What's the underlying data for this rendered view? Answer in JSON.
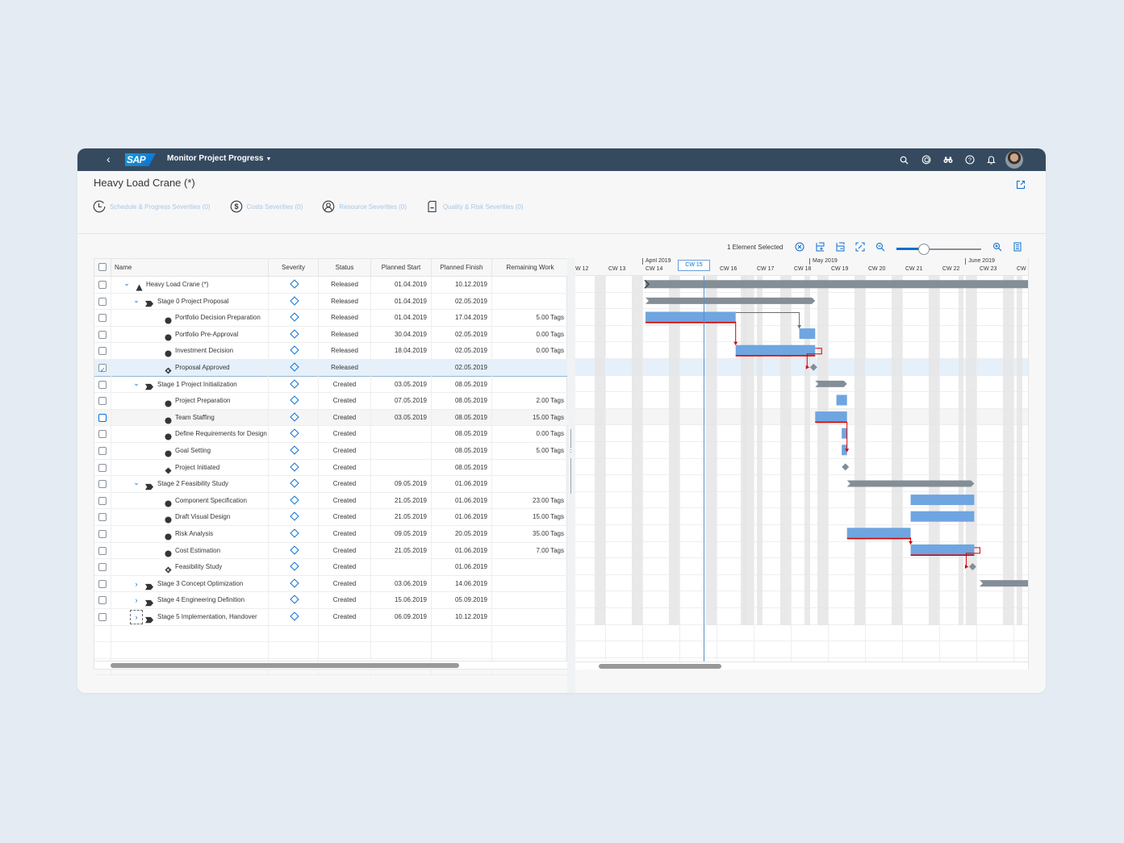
{
  "shell": {
    "back_label": "<",
    "logo": "SAP",
    "app_title": "Monitor Project Progress",
    "actions": [
      "search-icon",
      "co-pilot-icon",
      "binoculars-icon",
      "help-icon",
      "notification-bell-icon"
    ]
  },
  "header": {
    "title": "Heavy Load Crane (*)",
    "share_icon": "share-icon",
    "severity_tabs": [
      {
        "icon": "clock-icon",
        "label": "Schedule & Progress Severities (0)"
      },
      {
        "icon": "dollar-icon",
        "label": "Costs Severities (0)"
      },
      {
        "icon": "person-icon",
        "label": "Resource Severities (0)"
      },
      {
        "icon": "document-icon",
        "label": "Quality & Risk Severities (0)"
      }
    ]
  },
  "toolbar": {
    "selection_text": "1 Element Selected",
    "icons": [
      "clear-selection-icon",
      "expand-all-icon",
      "collapse-all-icon",
      "fit-to-screen-icon",
      "zoom-out-icon",
      "zoom-in-icon",
      "settings-icon"
    ],
    "zoom_level": 0.32
  },
  "table": {
    "columns": [
      "Name",
      "Severity",
      "Status",
      "Planned Start",
      "Planned Finish",
      "Remaining Work"
    ],
    "rows": [
      {
        "level": 0,
        "expand": "open",
        "type": "project",
        "name": "Heavy Load Crane (*)",
        "status": "Released",
        "start": "01.04.2019",
        "finish": "10.12.2019",
        "work": "",
        "checked": false
      },
      {
        "level": 1,
        "expand": "open",
        "type": "phase",
        "name": "Stage 0 Project Proposal",
        "status": "Released",
        "start": "01.04.2019",
        "finish": "02.05.2019",
        "work": "",
        "checked": false
      },
      {
        "level": 2,
        "expand": "",
        "type": "task",
        "name": "Portfolio Decision Preparation",
        "status": "Released",
        "start": "01.04.2019",
        "finish": "17.04.2019",
        "work": "5.00 Tags",
        "checked": false
      },
      {
        "level": 2,
        "expand": "",
        "type": "task",
        "name": "Portfolio Pre-Approval",
        "status": "Released",
        "start": "30.04.2019",
        "finish": "02.05.2019",
        "work": "0.00 Tags",
        "checked": false
      },
      {
        "level": 2,
        "expand": "",
        "type": "task",
        "name": "Investment Decision",
        "status": "Released",
        "start": "18.04.2019",
        "finish": "02.05.2019",
        "work": "0.00 Tags",
        "checked": false
      },
      {
        "level": 2,
        "expand": "",
        "type": "gate",
        "name": "Proposal Approved",
        "status": "Released",
        "start": "",
        "finish": "02.05.2019",
        "work": "",
        "checked": true
      },
      {
        "level": 1,
        "expand": "open",
        "type": "phase",
        "name": "Stage 1 Project Initialization",
        "status": "Created",
        "start": "03.05.2019",
        "finish": "08.05.2019",
        "work": "",
        "checked": false
      },
      {
        "level": 2,
        "expand": "",
        "type": "task",
        "name": "Project Preparation",
        "status": "Created",
        "start": "07.05.2019",
        "finish": "08.05.2019",
        "work": "2.00 Tags",
        "checked": false
      },
      {
        "level": 2,
        "expand": "",
        "type": "task",
        "name": "Team Staffing",
        "status": "Created",
        "start": "03.05.2019",
        "finish": "08.05.2019",
        "work": "15.00 Tags",
        "checked": false
      },
      {
        "level": 2,
        "expand": "",
        "type": "task",
        "name": "Define Requirements for Design",
        "status": "Created",
        "start": "",
        "finish": "08.05.2019",
        "work": "0.00 Tags",
        "checked": false
      },
      {
        "level": 2,
        "expand": "",
        "type": "task",
        "name": "Goal Setting",
        "status": "Created",
        "start": "",
        "finish": "08.05.2019",
        "work": "5.00 Tags",
        "checked": false
      },
      {
        "level": 2,
        "expand": "",
        "type": "milestone",
        "name": "Project Initiated",
        "status": "Created",
        "start": "",
        "finish": "08.05.2019",
        "work": "",
        "checked": false
      },
      {
        "level": 1,
        "expand": "open",
        "type": "phase",
        "name": "Stage 2 Feasibility Study",
        "status": "Created",
        "start": "09.05.2019",
        "finish": "01.06.2019",
        "work": "",
        "checked": false
      },
      {
        "level": 2,
        "expand": "",
        "type": "task",
        "name": "Component Specification",
        "status": "Created",
        "start": "21.05.2019",
        "finish": "01.06.2019",
        "work": "23.00 Tags",
        "checked": false
      },
      {
        "level": 2,
        "expand": "",
        "type": "task",
        "name": "Draft Visual Design",
        "status": "Created",
        "start": "21.05.2019",
        "finish": "01.06.2019",
        "work": "15.00 Tags",
        "checked": false
      },
      {
        "level": 2,
        "expand": "",
        "type": "task",
        "name": "Risk Analysis",
        "status": "Created",
        "start": "09.05.2019",
        "finish": "20.05.2019",
        "work": "35.00 Tags",
        "checked": false
      },
      {
        "level": 2,
        "expand": "",
        "type": "task",
        "name": "Cost Estimation",
        "status": "Created",
        "start": "21.05.2019",
        "finish": "01.06.2019",
        "work": "7.00 Tags",
        "checked": false
      },
      {
        "level": 2,
        "expand": "",
        "type": "gate",
        "name": "Feasibility Study",
        "status": "Created",
        "start": "",
        "finish": "01.06.2019",
        "work": "",
        "checked": false
      },
      {
        "level": 1,
        "expand": "closed",
        "type": "phase",
        "name": "Stage 3 Concept Optimization",
        "status": "Created",
        "start": "03.06.2019",
        "finish": "14.06.2019",
        "work": "",
        "checked": false
      },
      {
        "level": 1,
        "expand": "closed",
        "type": "phase",
        "name": "Stage 4 Engineering Definition",
        "status": "Created",
        "start": "15.06.2019",
        "finish": "05.09.2019",
        "work": "",
        "checked": false
      },
      {
        "level": 1,
        "expand": "closed",
        "type": "phase",
        "name": "Stage 5 Implementation, Handover",
        "status": "Created",
        "start": "06.09.2019",
        "finish": "10.12.2019",
        "work": "",
        "checked": false
      }
    ],
    "severity_icon": "diamond-icon",
    "empty_rows": 3
  },
  "gantt": {
    "months": [
      {
        "label": "April 2019",
        "week_index": 2
      },
      {
        "label": "May 2019",
        "week_index": 6.5
      },
      {
        "label": "June 2019",
        "week_index": 10.7
      }
    ],
    "weeks": [
      "W 12",
      "CW 13",
      "CW 14",
      "CW 15",
      "CW 16",
      "CW 17",
      "CW 18",
      "CW 19",
      "CW 20",
      "CW 21",
      "CW 22",
      "CW 23",
      "CW"
    ],
    "current_week": "CW 15",
    "colors": {
      "summary": "#848e96",
      "task": "#6fa5e0",
      "critical": "#d50000",
      "milestone": "#848e96",
      "today_line": "#5b8fc9"
    }
  }
}
